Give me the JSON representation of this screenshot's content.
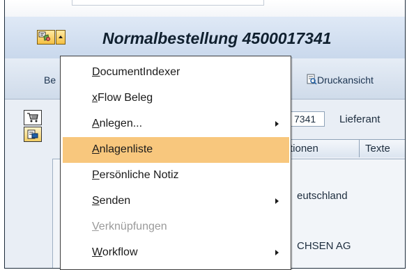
{
  "window": {
    "title": "Normalbestellung 4500017341"
  },
  "toolbar": {
    "left_fragment": "Be",
    "print_preview_label": "Druckansicht"
  },
  "header": {
    "doc_number_fragment": "7341",
    "vendor_label": "Lieferant"
  },
  "tabs": [
    {
      "label": "tionen"
    },
    {
      "label": "Texte"
    }
  ],
  "content": {
    "country_fragment": "eutschland",
    "company_fragment": "CHSEN AG"
  },
  "menu": {
    "items": [
      {
        "label": "DocumentIndexer",
        "state": "normal",
        "submenu": false
      },
      {
        "label": "xFlow Beleg",
        "state": "normal",
        "submenu": false
      },
      {
        "label": "Anlegen...",
        "state": "normal",
        "submenu": true
      },
      {
        "label": "Anlagenliste",
        "state": "highlighted",
        "submenu": false
      },
      {
        "label": "Persönliche Notiz",
        "state": "normal",
        "submenu": false
      },
      {
        "label": "Senden",
        "state": "normal",
        "submenu": true
      },
      {
        "label": "Verknüpfungen",
        "state": "disabled",
        "submenu": false
      },
      {
        "label": "Workflow",
        "state": "normal",
        "submenu": true
      }
    ]
  },
  "icons": {
    "sysmenu": "services-for-object-icon",
    "cart": "shopping-cart-icon",
    "document": "document-overview-icon",
    "print": "print-preview-icon"
  },
  "colors": {
    "highlight": "#f8c77d",
    "title_bar": "#c9d8ec",
    "button_gold": "#f5c042"
  }
}
